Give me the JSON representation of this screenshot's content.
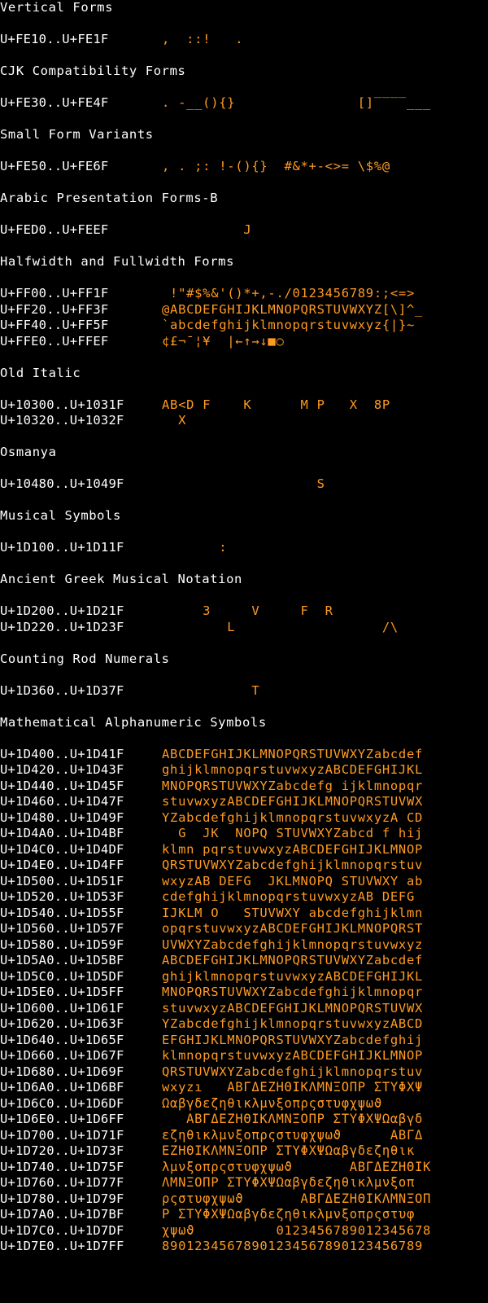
{
  "colors": {
    "background": "#000000",
    "label": "#ffffff",
    "glyph": "#ff9a22"
  },
  "sections": [
    {
      "title": "Vertical Forms",
      "rows": [
        {
          "range": "U+FE10..U+FE1F",
          "glyphs": ",  ::!   ."
        }
      ]
    },
    {
      "title": "CJK Compatibility Forms",
      "rows": [
        {
          "range": "U+FE30..U+FE4F",
          "glyphs": ". -__(){}               []‾‾‾‾___"
        }
      ]
    },
    {
      "title": "Small Form Variants",
      "rows": [
        {
          "range": "U+FE50..U+FE6F",
          "glyphs": ", . ;: !-(){}  #&*+-<>= \\$%@"
        }
      ]
    },
    {
      "title": "Arabic Presentation Forms-B",
      "rows": [
        {
          "range": "U+FED0..U+FEEF",
          "glyphs": "          J"
        }
      ]
    },
    {
      "title": "Halfwidth and Fullwidth Forms",
      "rows": [
        {
          "range": "U+FF00..U+FF1F",
          "glyphs": " !\"#$%&'()*+,-./0123456789:;<=>"
        },
        {
          "range": "U+FF20..U+FF3F",
          "glyphs": "@ABCDEFGHIJKLMNOPQRSTUVWXYZ[\\]^_"
        },
        {
          "range": "U+FF40..U+FF5F",
          "glyphs": "`abcdefghijklmnopqrstuvwxyz{|}~"
        },
        {
          "range": "U+FFE0..U+FFEF",
          "glyphs": "¢£¬¯¦¥  |←↑→↓■○"
        }
      ]
    },
    {
      "title": "Old Italic",
      "rows": [
        {
          "range": "U+10300..U+1031F",
          "glyphs": "AB<D F    K      M P   X  8P"
        },
        {
          "range": "U+10320..U+1032F",
          "glyphs": "  X"
        }
      ]
    },
    {
      "title": "Osmanya",
      "rows": [
        {
          "range": "U+10480..U+1049F",
          "glyphs": "                   S"
        }
      ]
    },
    {
      "title": "Musical Symbols",
      "rows": [
        {
          "range": "U+1D100..U+1D11F",
          "glyphs": "       :"
        }
      ]
    },
    {
      "title": "Ancient Greek Musical Notation",
      "rows": [
        {
          "range": "U+1D200..U+1D21F",
          "glyphs": "     3     V     F  R"
        },
        {
          "range": "U+1D220..U+1D23F",
          "glyphs": "        L                  /\\"
        }
      ]
    },
    {
      "title": "Counting Rod Numerals",
      "rows": [
        {
          "range": "U+1D360..U+1D37F",
          "glyphs": "           T"
        }
      ]
    },
    {
      "title": "Mathematical Alphanumeric Symbols",
      "rows": [
        {
          "range": "U+1D400..U+1D41F",
          "glyphs": "ABCDEFGHIJKLMNOPQRSTUVWXYZabcdef"
        },
        {
          "range": "U+1D420..U+1D43F",
          "glyphs": "ghijklmnopqrstuvwxyzABCDEFGHIJKL"
        },
        {
          "range": "U+1D440..U+1D45F",
          "glyphs": "MNOPQRSTUVWXYZabcdefg ijklmnopqr"
        },
        {
          "range": "U+1D460..U+1D47F",
          "glyphs": "stuvwxyzABCDEFGHIJKLMNOPQRSTUVWX"
        },
        {
          "range": "U+1D480..U+1D49F",
          "glyphs": "YZabcdefghijklmnopqrstuvwxyzA CD"
        },
        {
          "range": "U+1D4A0..U+1D4BF",
          "glyphs": "  G  JK  NOPQ STUVWXYZabcd f hij"
        },
        {
          "range": "U+1D4C0..U+1D4DF",
          "glyphs": "klmn pqrstuvwxyzABCDEFGHIJKLMNOP"
        },
        {
          "range": "U+1D4E0..U+1D4FF",
          "glyphs": "QRSTUVWXYZabcdefghijklmnopqrstuv"
        },
        {
          "range": "U+1D500..U+1D51F",
          "glyphs": "wxyzAB DEFG  JKLMNOPQ STUVWXY ab"
        },
        {
          "range": "U+1D520..U+1D53F",
          "glyphs": "cdefghijklmnopqrstuvwxyzAB DEFG "
        },
        {
          "range": "U+1D540..U+1D55F",
          "glyphs": "IJKLM O   STUVWXY abcdefghijklmn"
        },
        {
          "range": "U+1D560..U+1D57F",
          "glyphs": "opqrstuvwxyzABCDEFGHIJKLMNOPQRST"
        },
        {
          "range": "U+1D580..U+1D59F",
          "glyphs": "UVWXYZabcdefghijklmnopqrstuvwxyz"
        },
        {
          "range": "U+1D5A0..U+1D5BF",
          "glyphs": "ABCDEFGHIJKLMNOPQRSTUVWXYZabcdef"
        },
        {
          "range": "U+1D5C0..U+1D5DF",
          "glyphs": "ghijklmnopqrstuvwxyzABCDEFGHIJKL"
        },
        {
          "range": "U+1D5E0..U+1D5FF",
          "glyphs": "MNOPQRSTUVWXYZabcdefghijklmnopqr"
        },
        {
          "range": "U+1D600..U+1D61F",
          "glyphs": "stuvwxyzABCDEFGHIJKLMNOPQRSTUVWX"
        },
        {
          "range": "U+1D620..U+1D63F",
          "glyphs": "YZabcdefghijklmnopqrstuvwxyzABCD"
        },
        {
          "range": "U+1D640..U+1D65F",
          "glyphs": "EFGHIJKLMNOPQRSTUVWXYZabcdefghij"
        },
        {
          "range": "U+1D660..U+1D67F",
          "glyphs": "klmnopqrstuvwxyzABCDEFGHIJKLMNOP"
        },
        {
          "range": "U+1D680..U+1D69F",
          "glyphs": "QRSTUVWXYZabcdefghijklmnopqrstuv"
        },
        {
          "range": "U+1D6A0..U+1D6BF",
          "glyphs": "wxyzı   ΑΒΓΔΕΖΗΘΙΚΛΜΝΞΟΠΡ ΣΤΥΦΧΨ"
        },
        {
          "range": "U+1D6C0..U+1D6DF",
          "glyphs": "Ωαβγδεζηθικλμνξοπρςστυφχψωϑ"
        },
        {
          "range": "U+1D6E0..U+1D6FF",
          "glyphs": "   ΑΒΓΔΕΖΗΘΙΚΛΜΝΞΟΠΡ ΣΤΥΦΧΨΩαβγδ"
        },
        {
          "range": "U+1D700..U+1D71F",
          "glyphs": "εζηθικλμνξοπρςστυφχψωϑ      ΑΒΓΔ"
        },
        {
          "range": "U+1D720..U+1D73F",
          "glyphs": "ΕΖΗΘΙΚΛΜΝΞΟΠΡ ΣΤΥΦΧΨΩαβγδεζηθικ"
        },
        {
          "range": "U+1D740..U+1D75F",
          "glyphs": "λμνξοπρςστυφχψωϑ       ΑΒΓΔΕΖΗΘΙΚ"
        },
        {
          "range": "U+1D760..U+1D77F",
          "glyphs": "ΛΜΝΞΟΠΡ ΣΤΥΦΧΨΩαβγδεζηθικλμνξοπ"
        },
        {
          "range": "U+1D780..U+1D79F",
          "glyphs": "ρςστυφχψωϑ       ΑΒΓΔΕΖΗΘΙΚΛΜΝΞΟΠ"
        },
        {
          "range": "U+1D7A0..U+1D7BF",
          "glyphs": "Ρ ΣΤΥΦΧΨΩαβγδεζηθικλμνξοπρςστυφ"
        },
        {
          "range": "U+1D7C0..U+1D7DF",
          "glyphs": "χψωϑ          0123456789012345678"
        },
        {
          "range": "U+1D7E0..U+1D7FF",
          "glyphs": "89012345678901234567890123456789"
        }
      ]
    }
  ]
}
